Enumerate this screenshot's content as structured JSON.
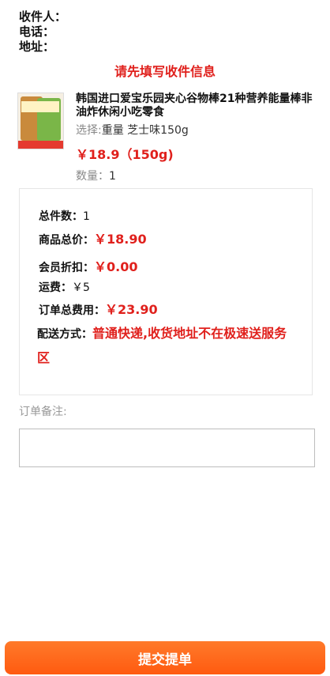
{
  "address": {
    "receiver_label": "收件人：",
    "phone_label": "电话：",
    "address_label": "地址："
  },
  "warning": "请先填写收件信息",
  "product": {
    "title": "韩国进口爱宝乐园夹心谷物棒21种营养能量棒非油炸休闲小吃零食",
    "select_label": "选择:",
    "select_value": "重量 芝士味150g",
    "price": "￥18.9（150g)",
    "qty_label": "数量：",
    "qty_value": "1"
  },
  "summary": {
    "count_label": "总件数：",
    "count_value": "1",
    "goods_total_label": "商品总价：",
    "goods_total_value": "￥18.90",
    "member_discount_label": "会员折扣：",
    "member_discount_value": "￥0.00",
    "freight_label": "运费：",
    "freight_value": "￥5",
    "order_total_label": "订单总费用：",
    "order_total_value": "￥23.90",
    "delivery_label": "配送方式：",
    "delivery_value": "普通快递,收货地址不在极速送服务区"
  },
  "note": {
    "label": "订单备注:",
    "placeholder": ""
  },
  "submit_label": "提交提单",
  "colors": {
    "accent": "#e0201c",
    "button": "#ff6a1a"
  }
}
